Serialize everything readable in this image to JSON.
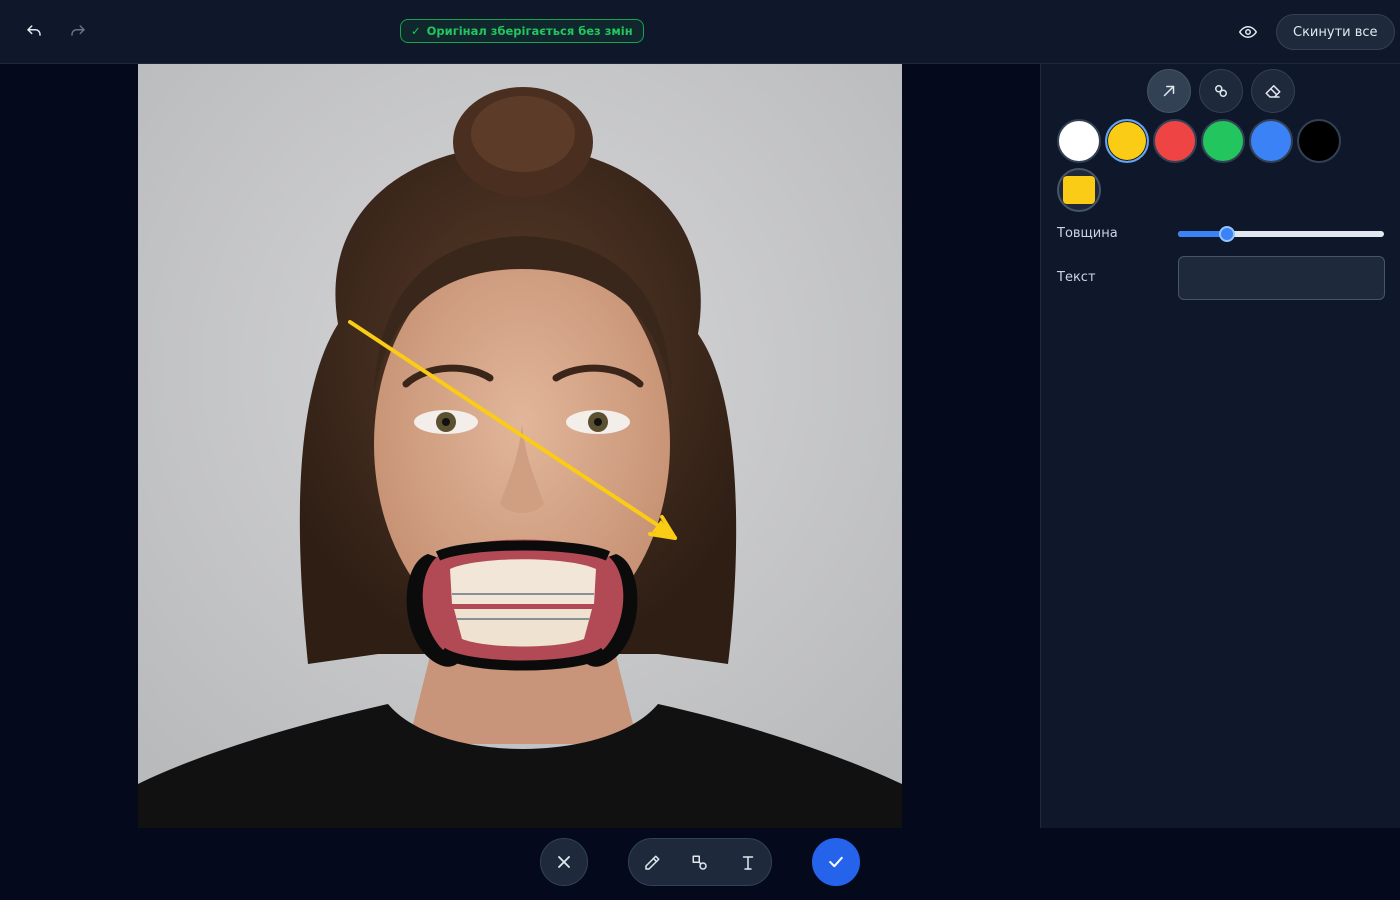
{
  "header": {
    "status_badge": "Оригінал зберігається без змін",
    "status_check": "✓",
    "reset_label": "Скинути все",
    "icons": [
      "undo-icon",
      "redo-icon",
      "eye-icon"
    ]
  },
  "panel": {
    "tools": [
      {
        "name": "arrow-tool",
        "icon": "arrow-up-right-icon",
        "active": true
      },
      {
        "name": "shapes-tool",
        "icon": "link-shapes-icon",
        "active": false
      },
      {
        "name": "eraser-tool",
        "icon": "eraser-icon",
        "active": false
      }
    ],
    "colors": [
      {
        "name": "white",
        "hex": "#ffffff"
      },
      {
        "name": "yellow",
        "hex": "#facc15"
      },
      {
        "name": "red",
        "hex": "#ef4444"
      },
      {
        "name": "green",
        "hex": "#22c55e"
      },
      {
        "name": "blue",
        "hex": "#3b82f6"
      },
      {
        "name": "black",
        "hex": "#000000"
      }
    ],
    "selected_color": "#facc15",
    "custom_color": "#facc15",
    "thickness_label": "Товщина",
    "thickness_value": 0.24,
    "text_label": "Текст",
    "text_value": "",
    "text_placeholder": ""
  },
  "annotation": {
    "type": "arrow",
    "color": "#facc15"
  },
  "bottom": {
    "icons": [
      "close-icon",
      "pencil-icon",
      "shapes-icon",
      "text-cursor-icon",
      "check-icon"
    ],
    "confirm_color": "#2563eb"
  }
}
